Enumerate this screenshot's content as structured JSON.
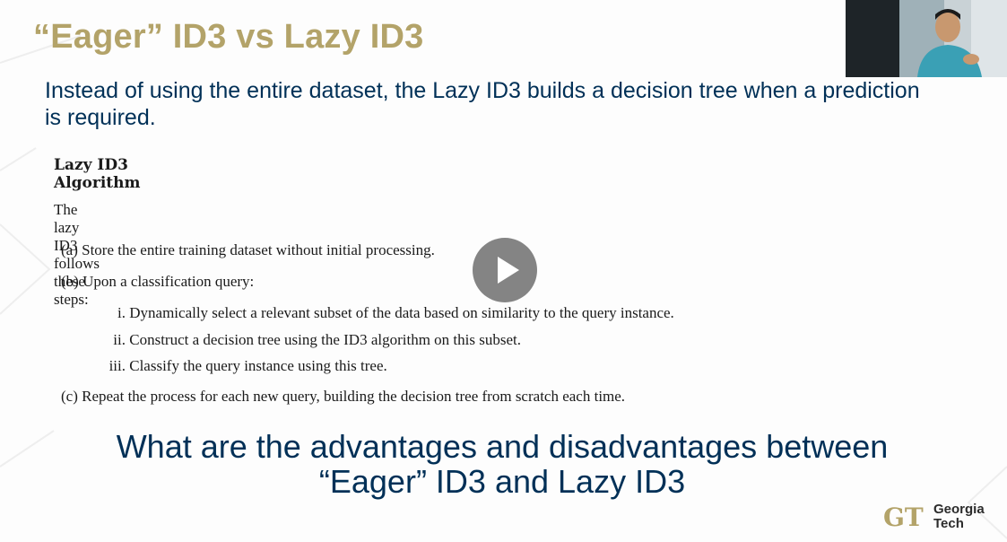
{
  "slide": {
    "title": "“Eager” ID3 vs Lazy ID3",
    "subtitle": "Instead of using the entire dataset, the Lazy ID3 builds a decision tree when a prediction is required.",
    "algorithm": {
      "heading": "Lazy ID3 Algorithm",
      "intro": "The lazy ID3 follows these steps:",
      "steps": [
        {
          "marker": "(a)",
          "text": "Store the entire training dataset without initial processing."
        },
        {
          "marker": "(b)",
          "text": "Upon a classification query:"
        },
        {
          "marker": "i.",
          "text": "Dynamically select a relevant subset of the data based on similarity to the query instance."
        },
        {
          "marker": "ii.",
          "text": "Construct a decision tree using the ID3 algorithm on this subset."
        },
        {
          "marker": "iii.",
          "text": "Classify the query instance using this tree."
        },
        {
          "marker": "(c)",
          "text": "Repeat the process for each new query, building the decision tree from scratch each time."
        }
      ]
    },
    "question": "What are the advantages and disadvantages between “Eager” ID3 and Lazy ID3"
  },
  "logo": {
    "line1": "Georgia",
    "line2": "Tech",
    "monogram": "GT"
  },
  "player": {
    "play_icon": "play-icon"
  },
  "colors": {
    "title_gold": "#b3a369",
    "navy": "#003057"
  }
}
